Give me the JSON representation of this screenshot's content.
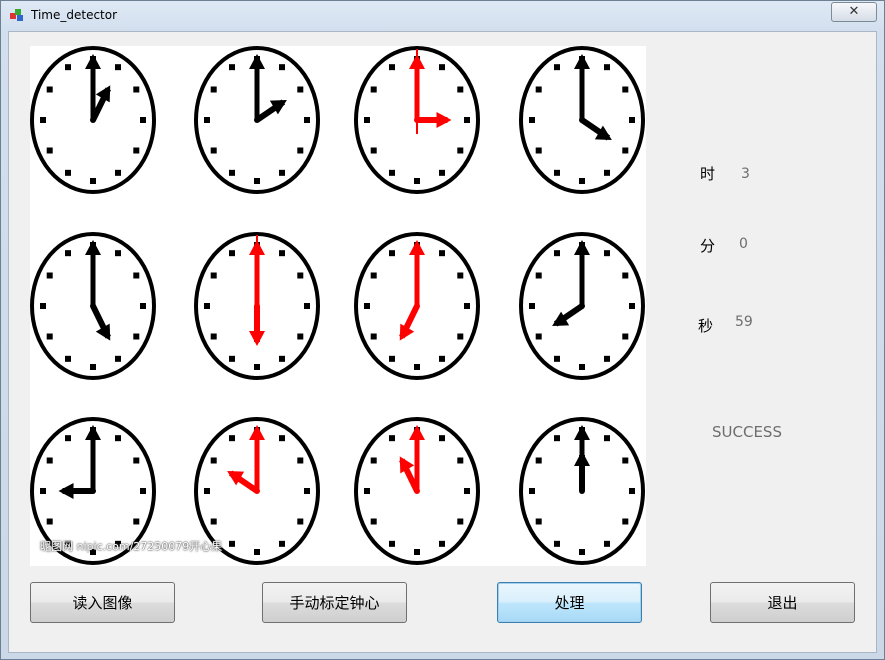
{
  "window": {
    "title": "Time_detector",
    "close_glyph": "✕"
  },
  "image_panel": {
    "watermark": "昵图网 nipic.com/27250079开心果",
    "clocks": [
      {
        "hour_angle": 30,
        "min_angle": 0,
        "red": false,
        "second": false
      },
      {
        "hour_angle": 60,
        "min_angle": 0,
        "red": false,
        "second": false
      },
      {
        "hour_angle": 90,
        "min_angle": 0,
        "red": true,
        "second": true
      },
      {
        "hour_angle": 120,
        "min_angle": 0,
        "red": false,
        "second": false
      },
      {
        "hour_angle": 150,
        "min_angle": 0,
        "red": false,
        "second": false
      },
      {
        "hour_angle": 180,
        "min_angle": 0,
        "red": true,
        "second": true
      },
      {
        "hour_angle": 210,
        "min_angle": 0,
        "red": true,
        "second": false
      },
      {
        "hour_angle": 240,
        "min_angle": 0,
        "red": false,
        "second": false
      },
      {
        "hour_angle": 270,
        "min_angle": 0,
        "red": false,
        "second": false
      },
      {
        "hour_angle": 300,
        "min_angle": 0,
        "red": true,
        "second": false
      },
      {
        "hour_angle": 330,
        "min_angle": 0,
        "red": true,
        "second": false
      },
      {
        "hour_angle": 0,
        "min_angle": 0,
        "red": false,
        "second": false
      }
    ]
  },
  "results": {
    "hour_label": "时",
    "hour_value": "3",
    "minute_label": "分",
    "minute_value": "0",
    "second_label": "秒",
    "second_value": "59",
    "status": "SUCCESS"
  },
  "buttons": {
    "load": "读入图像",
    "calibrate": "手动标定钟心",
    "process": "处理",
    "exit": "退出"
  },
  "colors": {
    "hand_black": "#000000",
    "hand_red": "#ff0000"
  }
}
